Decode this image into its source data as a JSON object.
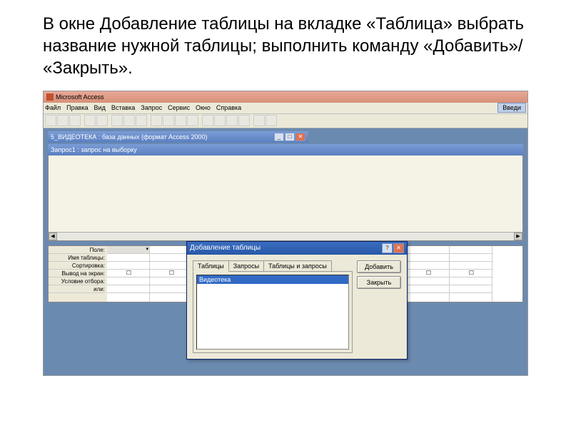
{
  "slide": {
    "text": "В окне Добавление таблицы на вкладке «Таблица» выбрать название нужной таблицы; выполнить команду «Добавить»/ «Закрыть»."
  },
  "access": {
    "title": "Microsoft Access",
    "menus": [
      "Файл",
      "Правка",
      "Вид",
      "Вставка",
      "Запрос",
      "Сервис",
      "Окно",
      "Справка"
    ],
    "type_prompt": "Введи"
  },
  "db_window": {
    "title": "5_ВИДЕОТЕКА : база данных (формат Access 2000)"
  },
  "query_window": {
    "title": "Запрос1 : запрос на выборку"
  },
  "grid": {
    "labels": [
      "Поле:",
      "Имя таблицы:",
      "Сортировка:",
      "Вывод на экран:",
      "Условие отбора:",
      "или:"
    ],
    "checkbox": "☐"
  },
  "dialog": {
    "title": "Добавление таблицы",
    "tabs": [
      "Таблицы",
      "Запросы",
      "Таблицы и запросы"
    ],
    "list_item": "Видеотека",
    "buttons": {
      "add": "Добавить",
      "close": "Закрыть"
    },
    "help": "?",
    "close_x": "✕"
  },
  "controls": {
    "min": "_",
    "max": "□",
    "close": "✕"
  }
}
